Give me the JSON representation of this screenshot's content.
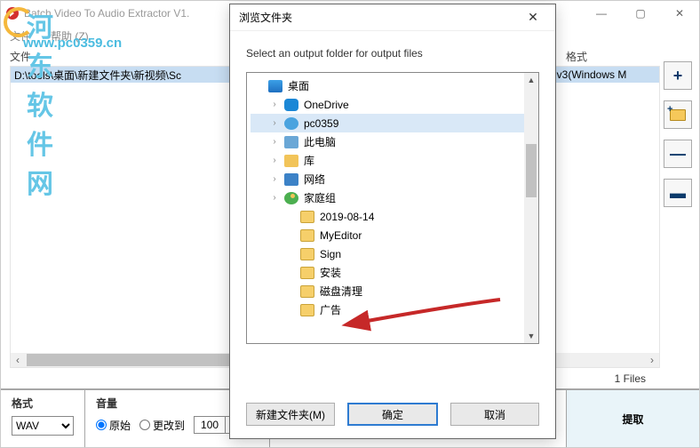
{
  "titlebar": {
    "text": "Batch Video To Audio Extractor V1."
  },
  "menubar": {
    "items": [
      "文件",
      "帮助 (Z)"
    ]
  },
  "columns": {
    "file": "文件",
    "format": "格式"
  },
  "list": {
    "rows": [
      {
        "file": "D:\\tools\\桌面\\新建文件夹\\新视频\\Sc",
        "format": "wmv3(Windows M"
      }
    ]
  },
  "watermark": {
    "brand": "河东软件网",
    "url": "www.pc0359.cn"
  },
  "files_count": "1 Files",
  "bottom": {
    "format_label": "格式",
    "format_value": "WAV",
    "volume_label": "音量",
    "radio_original": "原始",
    "radio_change_to": "更改到",
    "spin_value": "100",
    "percent": "%",
    "extract": "提取"
  },
  "dialog": {
    "title": "浏览文件夹",
    "prompt": "Select an output folder for output files",
    "tree": [
      {
        "level": 0,
        "icon": "desktop",
        "label": "桌面",
        "exp": ""
      },
      {
        "level": 1,
        "icon": "onedrive",
        "label": "OneDrive",
        "exp": "›"
      },
      {
        "level": 1,
        "icon": "user",
        "label": "pc0359",
        "exp": "›",
        "sel": true
      },
      {
        "level": 1,
        "icon": "pc",
        "label": "此电脑",
        "exp": "›"
      },
      {
        "level": 1,
        "icon": "lib",
        "label": "库",
        "exp": "›"
      },
      {
        "level": 1,
        "icon": "net",
        "label": "网络",
        "exp": "›"
      },
      {
        "level": 1,
        "icon": "home",
        "label": "家庭组",
        "exp": "›"
      },
      {
        "level": 2,
        "icon": "folder",
        "label": "2019-08-14",
        "exp": ""
      },
      {
        "level": 2,
        "icon": "folder",
        "label": "MyEditor",
        "exp": ""
      },
      {
        "level": 2,
        "icon": "folder",
        "label": "Sign",
        "exp": ""
      },
      {
        "level": 2,
        "icon": "folder",
        "label": "安装",
        "exp": ""
      },
      {
        "level": 2,
        "icon": "folder",
        "label": "磁盘清理",
        "exp": ""
      },
      {
        "level": 2,
        "icon": "folder",
        "label": "广告",
        "exp": ""
      }
    ],
    "new_folder": "新建文件夹(M)",
    "ok": "确定",
    "cancel": "取消"
  }
}
